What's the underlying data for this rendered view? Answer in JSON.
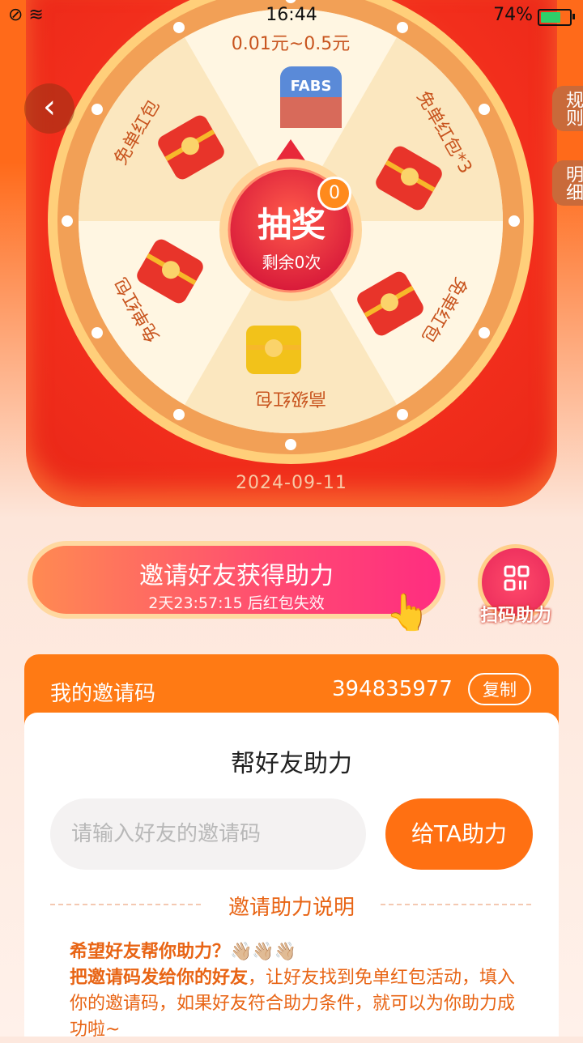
{
  "status_bar": {
    "time": "16:44",
    "battery": "74%",
    "battery_level": 0.74,
    "left_icons": "⊘ ≋"
  },
  "wheel": {
    "prizes": [
      "0.01元~0.5元",
      "免单红包*3",
      "免单红包",
      "高级红包",
      "免单红包",
      "免单红包"
    ],
    "center_label": "抽奖",
    "remaining": "剩余0次",
    "badge_count": "0",
    "date": "2024-09-11",
    "game_icon_text": "FABS"
  },
  "nav": {
    "back_icon": "‹",
    "rules": "规则",
    "details": "明细"
  },
  "invite": {
    "button_label": "邀请好友获得助力",
    "countdown": "2天23:57:15 后红包失效",
    "scan_label": "扫码助力"
  },
  "code": {
    "label": "我的邀请码",
    "value": "394835977",
    "copy": "复制"
  },
  "help": {
    "title": "帮好友助力",
    "placeholder": "请输入好友的邀请码",
    "value": "",
    "button": "给TA助力"
  },
  "explain": {
    "title": "邀请助力说明",
    "line1": "希望好友帮你助力？👋🏼👋🏼👋🏼",
    "bold": "把邀请码发给你的好友",
    "rest": "，让好友找到免单红包活动，填入你的邀请码，如果好友符合助力条件，就可以为你助力成功啦~"
  },
  "colors": {
    "accent": "#ff7012",
    "wheel_red": "#f22e1c",
    "text_orange": "#e86414"
  }
}
